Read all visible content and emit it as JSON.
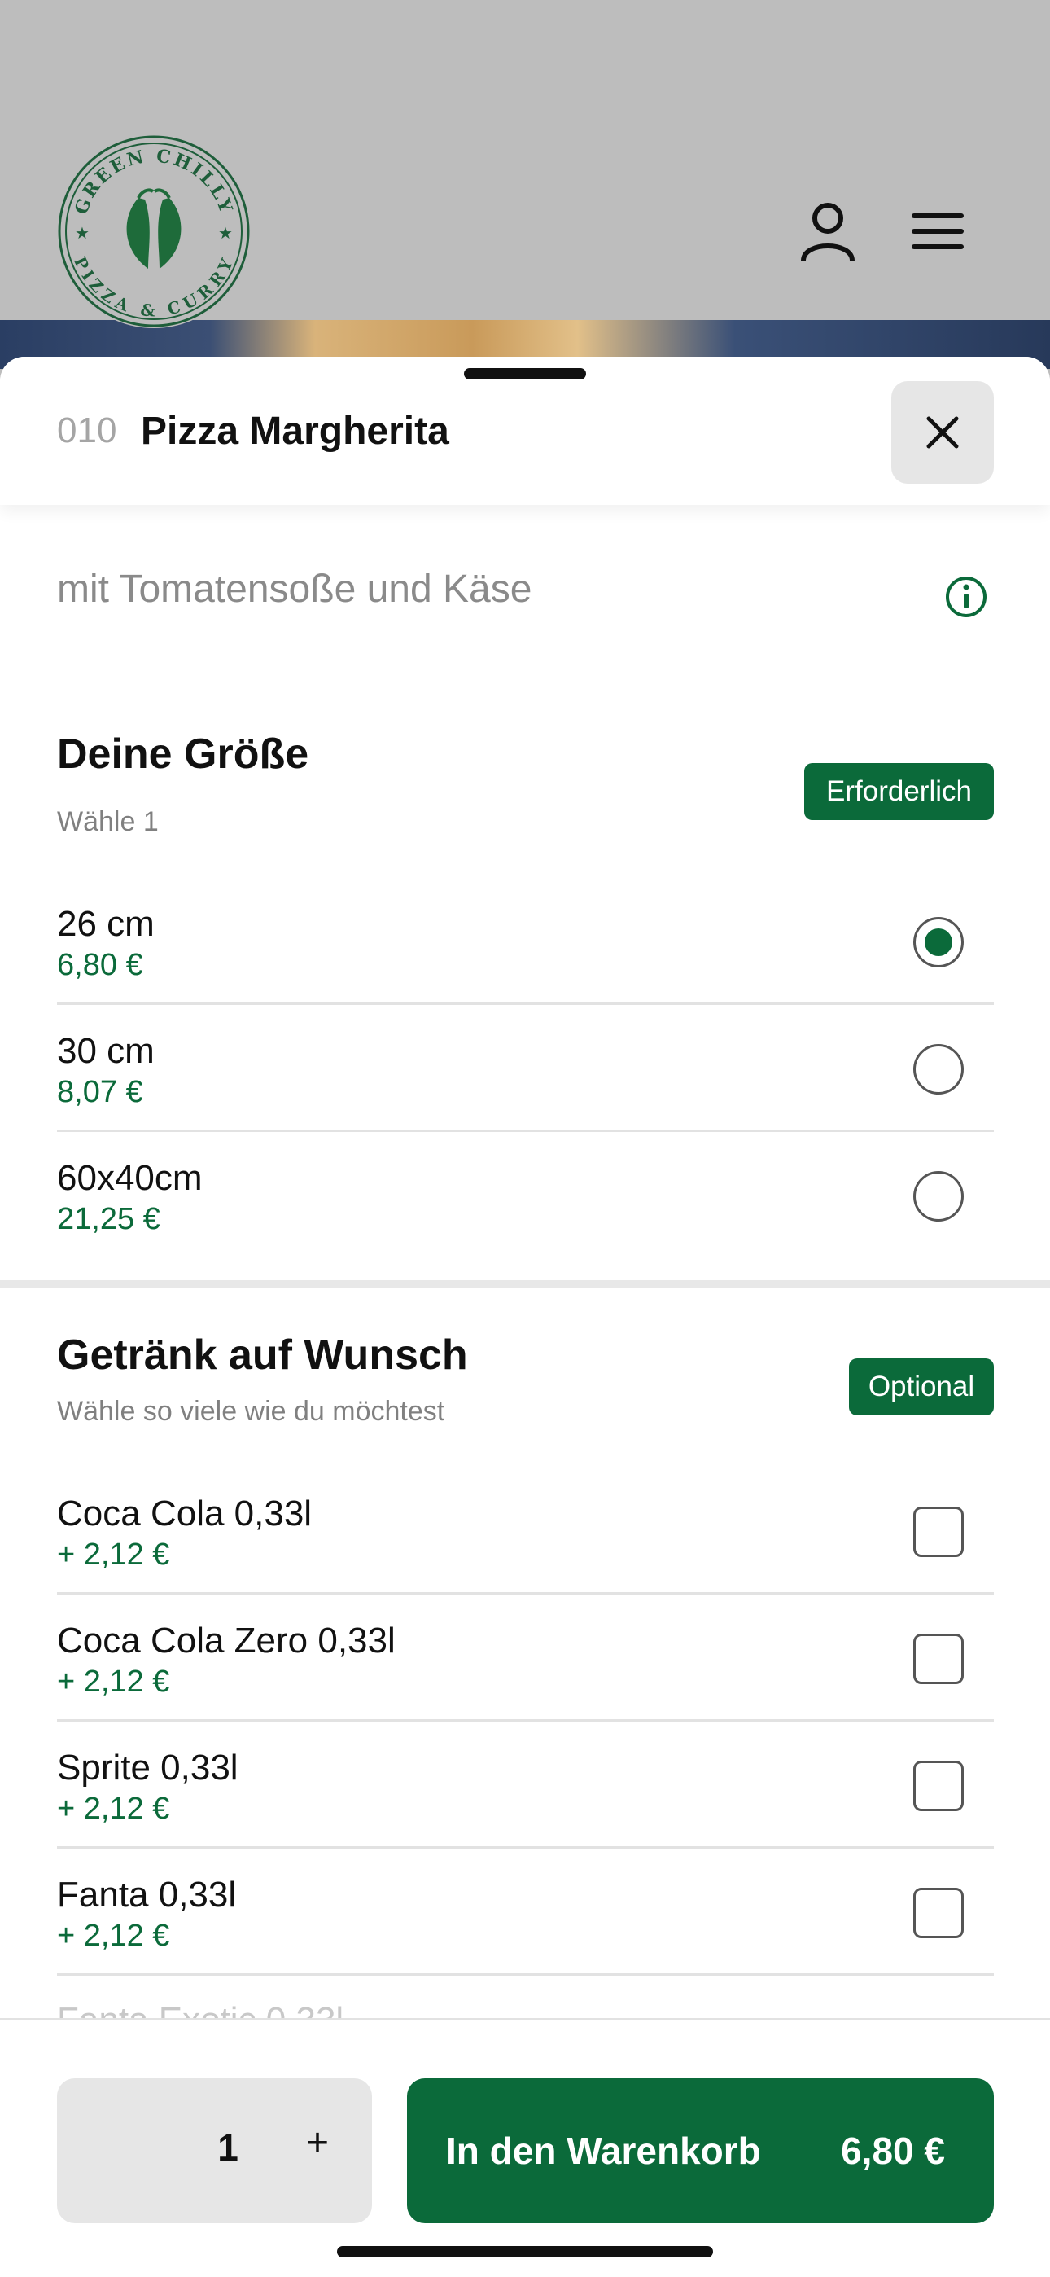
{
  "brand": {
    "logo_text_top": "GREEN CHILLY",
    "logo_text_bottom": "PIZZA & CURRY"
  },
  "header_icons": {
    "user": "user-icon",
    "menu": "hamburger-menu-icon"
  },
  "item": {
    "number": "010",
    "title": "Pizza Margherita",
    "description": "mit Tomatensoße und Käse"
  },
  "size_section": {
    "title": "Deine Größe",
    "subtitle": "Wähle 1",
    "badge": "Erforderlich",
    "options": [
      {
        "label": "26 cm",
        "price": "6,80 €",
        "selected": true
      },
      {
        "label": "30 cm",
        "price": "8,07 €",
        "selected": false
      },
      {
        "label": "60x40cm",
        "price": "21,25 €",
        "selected": false
      }
    ]
  },
  "drink_section": {
    "title": "Getränk auf Wunsch",
    "subtitle": "Wähle so viele wie du möchtest",
    "badge": "Optional",
    "options": [
      {
        "label": "Coca Cola 0,33l",
        "price": "+ 2,12 €"
      },
      {
        "label": "Coca Cola Zero 0,33l",
        "price": "+ 2,12 €"
      },
      {
        "label": "Sprite 0,33l",
        "price": "+ 2,12 €"
      },
      {
        "label": "Fanta 0,33l",
        "price": "+ 2,12 €"
      }
    ],
    "partially_visible": "Fanta Exotic 0,33l"
  },
  "footer": {
    "quantity": "1",
    "plus": "+",
    "cart_label": "In den Warenkorb",
    "cart_price": "6,80 €"
  },
  "colors": {
    "accent": "#0b6a3a",
    "background": "#bdbdbd"
  }
}
